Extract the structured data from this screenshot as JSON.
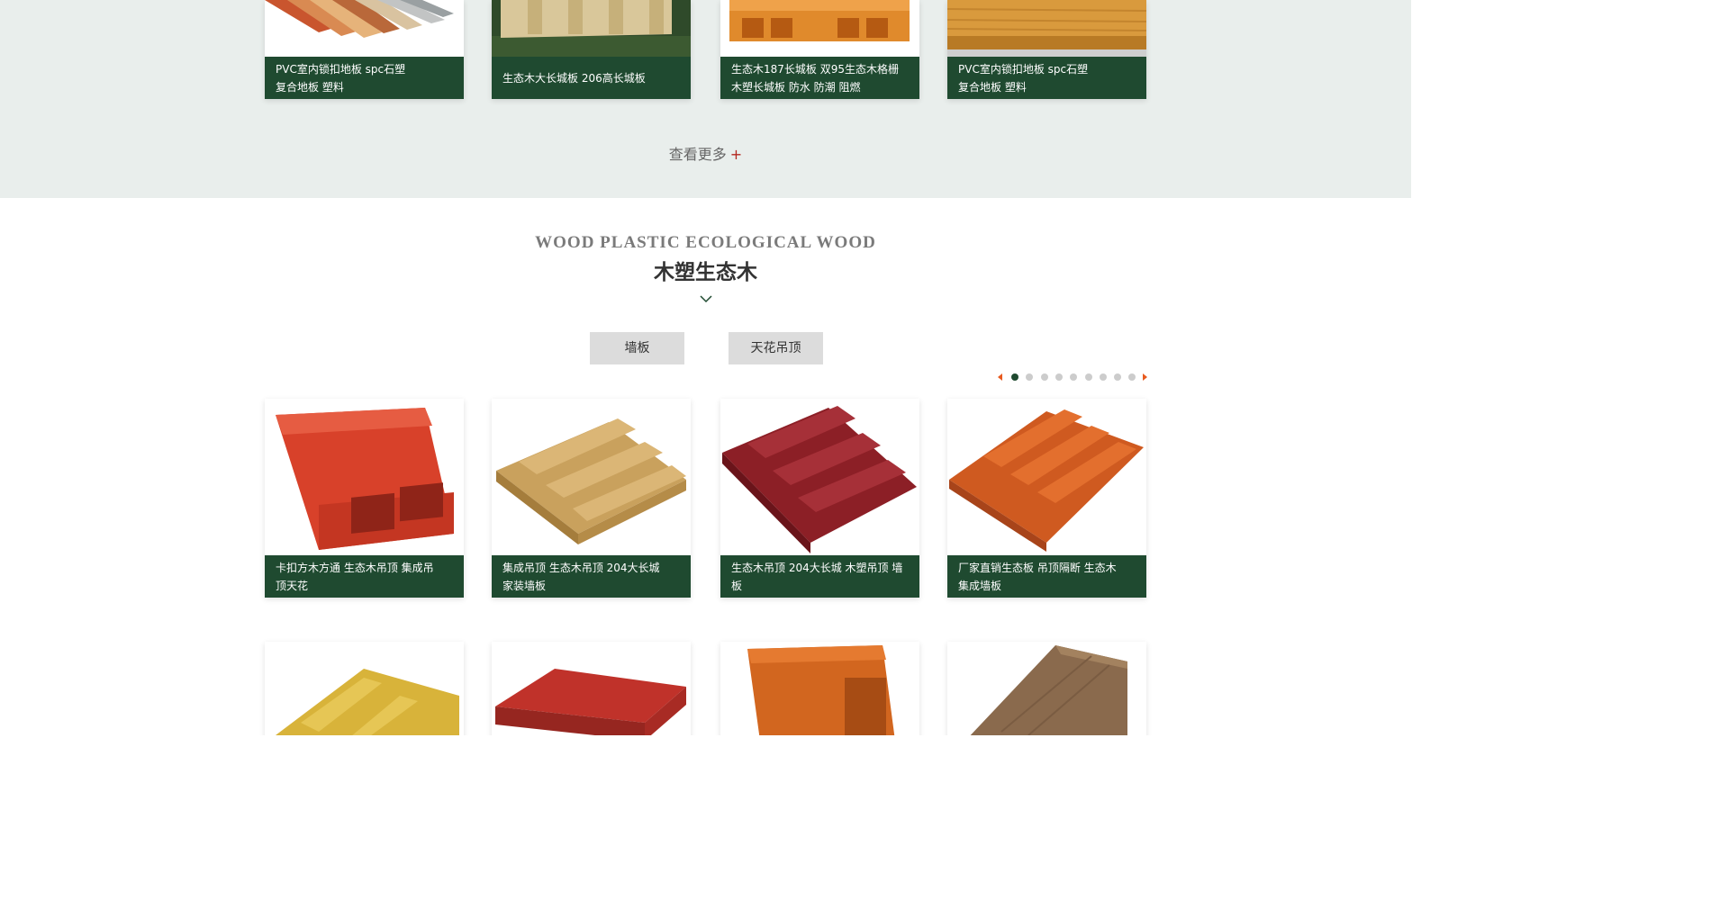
{
  "top_cards": [
    {
      "caption_lines": [
        "PVC室内锁扣地板 spc石塑",
        "复合地板 塑料"
      ],
      "icon": "laminate-floor-samples"
    },
    {
      "caption_lines": [
        "生态木大长城板 206高长城板"
      ],
      "icon": "wood-plastic-panel-on-grass"
    },
    {
      "caption_lines": [
        "生态木187长城板 双95生态木格栅",
        "木塑长城板 防水 防潮 阻燃"
      ],
      "icon": "hollow-wood-plastic-board"
    },
    {
      "caption_lines": [
        "PVC室内锁扣地板 spc石塑",
        "复合地板 塑料"
      ],
      "icon": "wood-grain-board"
    }
  ],
  "more_link": {
    "label": "查看更多",
    "plus": "+"
  },
  "section": {
    "en_title": "WOOD PLASTIC ECOLOGICAL WOOD",
    "cn_title": "木塑生态木"
  },
  "tabs": [
    {
      "label": "墙板"
    },
    {
      "label": "天花吊顶"
    }
  ],
  "pager": {
    "total": 9,
    "active": 1
  },
  "products_row1": [
    {
      "caption_lines": [
        "卡扣方木方通 生态木吊顶 集成吊",
        "顶天花"
      ],
      "color": "#d8412a",
      "icon": "square-tube-icon"
    },
    {
      "caption_lines": [
        "集成吊顶 生态木吊顶 204大长城",
        "家装墙板"
      ],
      "color": "#c9a15d",
      "icon": "great-wall-panel-icon"
    },
    {
      "caption_lines": [
        "生态木吊顶 204大长城 木塑吊顶 墙板"
      ],
      "color": "#8c1f26",
      "icon": "red-great-wall-panel-icon"
    },
    {
      "caption_lines": [
        "厂家直销生态板 吊顶隔断 生态木",
        "集成墙板"
      ],
      "color": "#cf5a20",
      "icon": "orange-great-wall-panel-icon"
    }
  ],
  "products_row2": [
    {
      "color": "#d8b33a",
      "icon": "yellow-panel-icon"
    },
    {
      "color": "#c0322a",
      "icon": "red-ceiling-panel-icon"
    },
    {
      "color": "#d2661f",
      "icon": "square-beam-icon"
    },
    {
      "color": "#8a6a4d",
      "icon": "walnut-board-icon"
    }
  ]
}
